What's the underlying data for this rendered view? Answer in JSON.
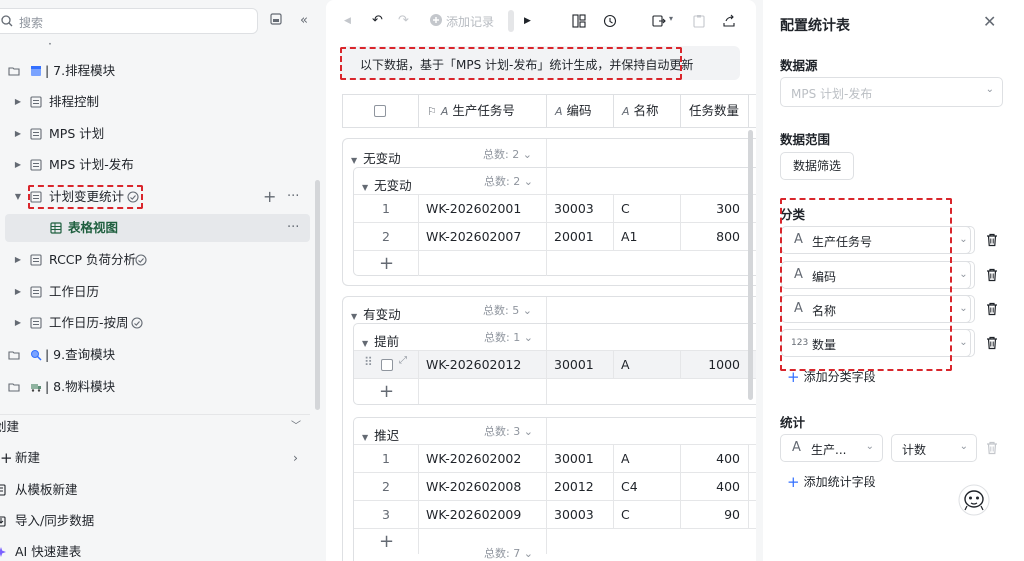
{
  "sidebar": {
    "search_placeholder": "搜索",
    "dot": "·",
    "items": [
      {
        "label": "| 7.排程模块"
      },
      {
        "label": "排程控制"
      },
      {
        "label": "MPS 计划"
      },
      {
        "label": "MPS 计划-发布"
      },
      {
        "label": "计划变更统计"
      },
      {
        "label": "表格视图"
      },
      {
        "label": "RCCP 负荷分析"
      },
      {
        "label": "工作日历"
      },
      {
        "label": "工作日历-按周"
      },
      {
        "label": "| 9.查询模块"
      },
      {
        "label": "| 8.物料模块"
      }
    ],
    "create_section": "创建",
    "new_label": "新建",
    "from_template": "从模板新建",
    "import_sync": "导入/同步数据",
    "ai_build": "AI 快速建表"
  },
  "toolbar": {
    "add_record": "添加记录"
  },
  "notice": "以下数据，基于「MPS 计划-发布」统计生成，并保持自动更新",
  "grid": {
    "columns": [
      "生产任务号",
      "编码",
      "名称",
      "任务数量"
    ],
    "total_label": "总数",
    "groups": [
      {
        "title": "无变动",
        "count": "2",
        "subgroups": [
          {
            "title": "无变动",
            "count": "2",
            "rows": [
              {
                "idx": "1",
                "task": "WK-202602001",
                "code": "30003",
                "name": "C",
                "qty": "300"
              },
              {
                "idx": "2",
                "task": "WK-202602007",
                "code": "20001",
                "name": "A1",
                "qty": "800"
              }
            ]
          }
        ]
      },
      {
        "title": "有变动",
        "count": "5",
        "subgroups": [
          {
            "title": "提前",
            "count": "1",
            "rows": [
              {
                "idx": "",
                "task": "WK-202602012",
                "code": "30001",
                "name": "A",
                "qty": "1000"
              }
            ]
          },
          {
            "title": "推迟",
            "count": "3",
            "rows": [
              {
                "idx": "1",
                "task": "WK-202602002",
                "code": "30001",
                "name": "A",
                "qty": "400"
              },
              {
                "idx": "2",
                "task": "WK-202602008",
                "code": "20012",
                "name": "C4",
                "qty": "400"
              },
              {
                "idx": "3",
                "task": "WK-202602009",
                "code": "30003",
                "name": "C",
                "qty": "90"
              }
            ]
          }
        ]
      }
    ],
    "grand_total": "7"
  },
  "panel": {
    "title": "配置统计表",
    "datasource_label": "数据源",
    "datasource_value": "MPS 计划-发布",
    "range_label": "数据范围",
    "filter_button": "数据筛选",
    "group_label": "分类",
    "group_fields": [
      {
        "type": "A",
        "name": "生产任务号"
      },
      {
        "type": "A",
        "name": "编码"
      },
      {
        "type": "A",
        "name": "名称"
      },
      {
        "type": "123",
        "name": "数量"
      }
    ],
    "add_group_field": "添加分类字段",
    "stat_label": "统计",
    "stat_field": "生产...",
    "stat_method": "计数",
    "add_stat_field": "添加统计字段"
  },
  "colors": {
    "highlight": "#d9262c",
    "accent": "#3370ff",
    "selected_text": "#1f5f3f"
  }
}
